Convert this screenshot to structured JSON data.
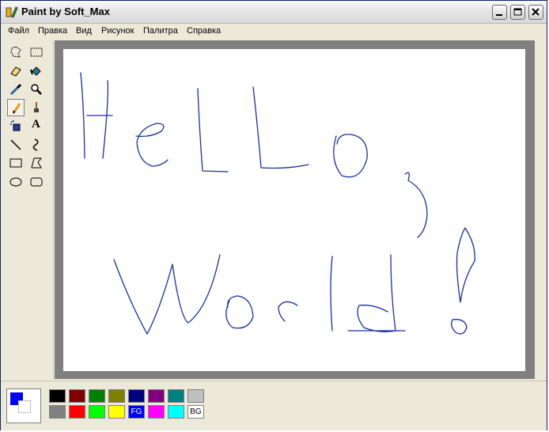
{
  "window": {
    "title": "Paint by Soft_Max"
  },
  "menu": [
    "Файл",
    "Правка",
    "Вид",
    "Рисунок",
    "Палитра",
    "Справка"
  ],
  "tools": [
    {
      "name": "free-select-icon"
    },
    {
      "name": "rect-select-icon"
    },
    {
      "name": "eraser-icon"
    },
    {
      "name": "fill-bucket-icon"
    },
    {
      "name": "color-picker-icon"
    },
    {
      "name": "magnifier-icon"
    },
    {
      "name": "pencil-icon",
      "selected": true
    },
    {
      "name": "brush-icon"
    },
    {
      "name": "airbrush-icon"
    },
    {
      "name": "text-icon",
      "glyph": "A"
    },
    {
      "name": "line-icon"
    },
    {
      "name": "curve-icon"
    },
    {
      "name": "rectangle-icon"
    },
    {
      "name": "polygon-icon"
    },
    {
      "name": "ellipse-icon"
    },
    {
      "name": "rounded-rect-icon"
    }
  ],
  "colors": {
    "foreground": "#0000ff",
    "background": "#ffffff",
    "stroke": "#1a2fa0"
  },
  "palette": [
    {
      "color": "#000000"
    },
    {
      "color": "#800000"
    },
    {
      "color": "#008000"
    },
    {
      "color": "#808000"
    },
    {
      "color": "#000080"
    },
    {
      "color": "#800080"
    },
    {
      "color": "#008080"
    },
    {
      "color": "#c0c0c0"
    },
    {
      "color": "#808080"
    },
    {
      "color": "#ff0000"
    },
    {
      "color": "#00ff00"
    },
    {
      "color": "#ffff00"
    },
    {
      "color": "#0000ff",
      "label": "FG"
    },
    {
      "color": "#ff00ff"
    },
    {
      "color": "#00ffff"
    },
    {
      "color": "#ffffff",
      "label": "BG"
    }
  ]
}
